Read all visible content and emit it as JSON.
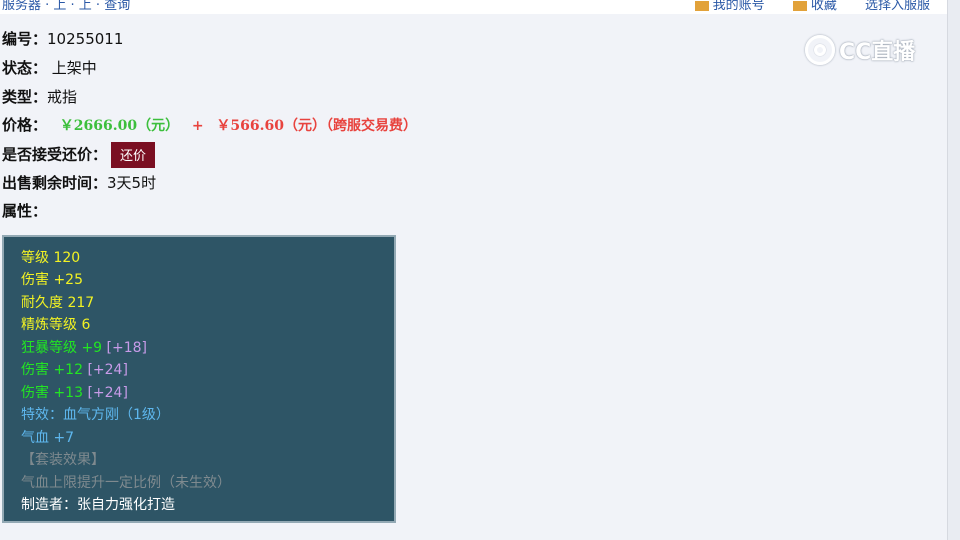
{
  "topbar": {
    "crumbs": "服务器 · 上 · 上 · 查询",
    "links": [
      "我的账号",
      "收藏",
      "选择入服服"
    ]
  },
  "item": {
    "id_label": "编号：",
    "id_value": "10255011",
    "status_label": "状态：",
    "status_value": "上架中",
    "type_label": "类型：",
    "type_value": "戒指",
    "price_label": "价格：",
    "price_main": "￥2666.00（元）",
    "price_plus": "+",
    "price_fee": "￥566.60（元）（跨服交易费）",
    "counter_label": "是否接受还价：",
    "counter_button": "还价",
    "time_label": "出售剩余时间：",
    "time_value": "3天5时",
    "attr_label": "属性："
  },
  "watermark": "CC直播",
  "attributes": {
    "level": "等级 120",
    "damage": "伤害 +25",
    "durability": "耐久度 217",
    "refine": "精炼等级 6",
    "berserk": "狂暴等级 +9",
    "berserk_bonus": "[+18]",
    "damage2": "伤害 +12",
    "damage2_bonus": "[+24]",
    "damage3": "伤害 +13",
    "damage3_bonus": "[+24]",
    "special": "特效：血气方刚（1级）",
    "hp": "气血 +7",
    "set_title": "【套装效果】",
    "set_effect": "气血上限提升一定比例（未生效）",
    "maker": "制造者：张自力强化打造"
  },
  "colors": {
    "box_bg": "#2e5566",
    "yellow": "#f2f223",
    "green": "#22e622",
    "purple": "#c79be8",
    "blue": "#5eb7ee",
    "gray": "#7f8a8f",
    "counter_button": "#7a0f22",
    "price_green": "#3cbf3c",
    "price_red": "#e8433e"
  }
}
